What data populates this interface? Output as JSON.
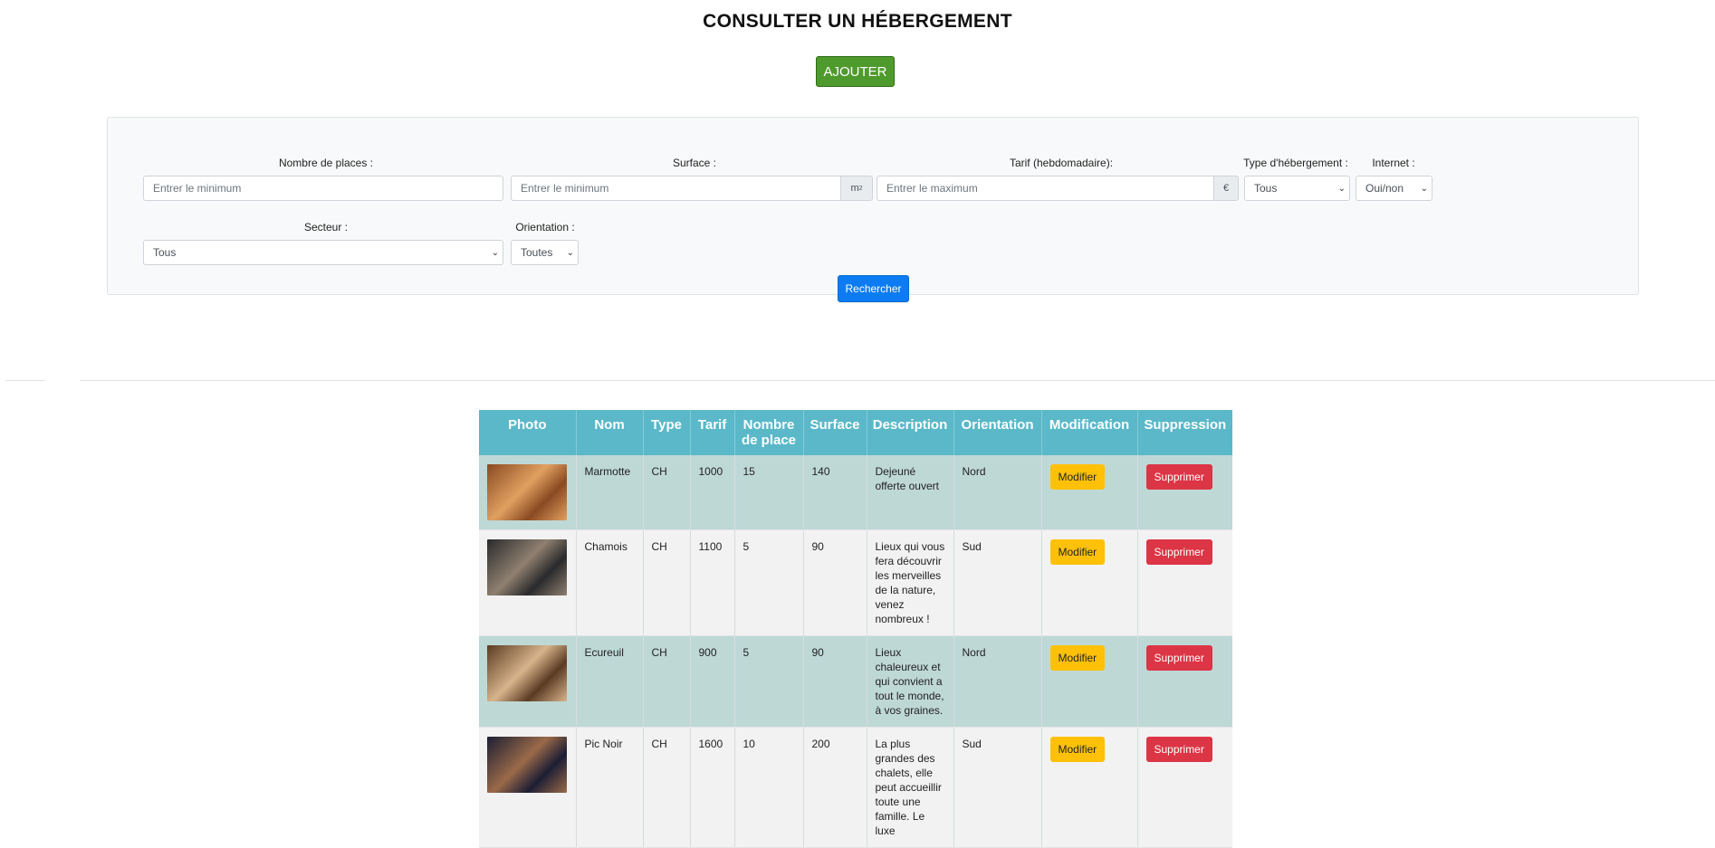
{
  "page_title": "CONSULTER UN HÉBERGEMENT",
  "add_button": "AJOUTER",
  "filters": {
    "places": {
      "label": "Nombre de places :",
      "placeholder": "Entrer le minimum"
    },
    "surface": {
      "label": "Surface :",
      "placeholder": "Entrer le minimum",
      "unit": "m",
      "unit_sup": "2"
    },
    "tarif": {
      "label": "Tarif (hebdomadaire):",
      "placeholder": "Entrer le maximum",
      "unit": "€"
    },
    "type": {
      "label": "Type d'hébergement :",
      "value": "Tous"
    },
    "internet": {
      "label": "Internet :",
      "value": "Oui/non"
    },
    "secteur": {
      "label": "Secteur :",
      "value": "Tous"
    },
    "orientation": {
      "label": "Orientation :",
      "value": "Toutes"
    },
    "search_button": "Rechercher"
  },
  "table": {
    "headers": [
      "Photo",
      "Nom",
      "Type",
      "Tarif",
      "Nombre de place",
      "Surface",
      "Description",
      "Orientation",
      "Modification",
      "Suppression"
    ],
    "rows": [
      {
        "nom": "Marmotte",
        "type": "CH",
        "tarif": "1000",
        "places": "15",
        "surface": "140",
        "description": "Dejeuné offerte ouvert",
        "orientation": "Nord",
        "photo_colors": [
          "#8a4a22",
          "#e0a060"
        ]
      },
      {
        "nom": "Chamois",
        "type": "CH",
        "tarif": "1100",
        "places": "5",
        "surface": "90",
        "description": "Lieux qui vous fera découvrir les merveilles de la nature, venez nombreux !",
        "orientation": "Sud",
        "photo_colors": [
          "#2a2a2c",
          "#8f8070"
        ]
      },
      {
        "nom": "Ecureuil",
        "type": "CH",
        "tarif": "900",
        "places": "5",
        "surface": "90",
        "description": "Lieux chaleureux et qui convient a tout le monde, à vos graines.",
        "orientation": "Nord",
        "photo_colors": [
          "#5a3a22",
          "#d8b48c"
        ]
      },
      {
        "nom": "Pic Noir",
        "type": "CH",
        "tarif": "1600",
        "places": "10",
        "surface": "200",
        "description": "La plus grandes des chalets, elle peut accueillir toute une famille. Le luxe",
        "orientation": "Sud",
        "photo_colors": [
          "#1c1e34",
          "#9a6a48"
        ]
      }
    ],
    "modify_label": "Modifier",
    "delete_label": "Supprimer"
  },
  "colors": {
    "add_button": "#4f9a2c",
    "search_button": "#0d7cf2",
    "header": "#5ab8c9",
    "row_odd": "#bed8d6",
    "row_even": "#f2f2f2",
    "modify": "#ffc107",
    "delete": "#dc3545"
  }
}
